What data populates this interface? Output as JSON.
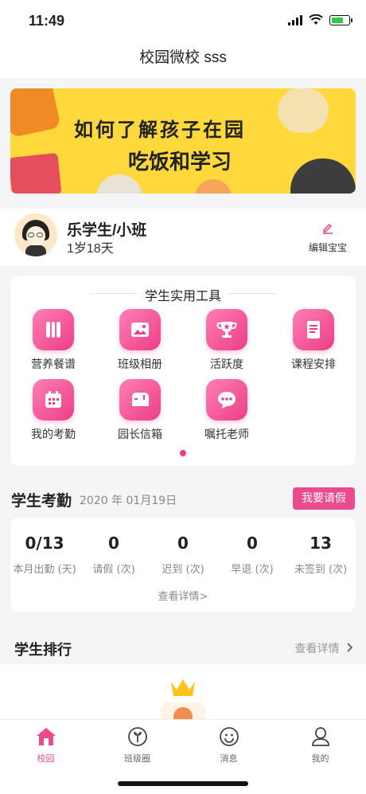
{
  "status_bar": {
    "time": "11:49"
  },
  "nav": {
    "title": "校园微校 sss"
  },
  "banner": {
    "line1": "如何了解孩子在园",
    "line2": "吃饭和学习"
  },
  "profile": {
    "name": "乐学生/小班",
    "age": "1岁18天",
    "edit_label": "编辑宝宝"
  },
  "tools": {
    "header": "学生实用工具",
    "items": [
      {
        "label": "营养餐谱",
        "icon": "utensils-icon"
      },
      {
        "label": "班级相册",
        "icon": "photo-album-icon"
      },
      {
        "label": "活跃度",
        "icon": "trophy-icon"
      },
      {
        "label": "课程安排",
        "icon": "book-icon"
      },
      {
        "label": "我的考勤",
        "icon": "calendar-icon"
      },
      {
        "label": "园长信箱",
        "icon": "mailbox-icon"
      },
      {
        "label": "嘱托老师",
        "icon": "chat-bubble-icon"
      }
    ]
  },
  "attendance": {
    "title": "学生考勤",
    "date": "2020 年 01月19日",
    "leave_button": "我要请假",
    "stats": [
      {
        "value": "0/13",
        "label": "本月出勤 (天)"
      },
      {
        "value": "0",
        "label": "请假 (次)"
      },
      {
        "value": "0",
        "label": "迟到 (次)"
      },
      {
        "value": "0",
        "label": "早退 (次)"
      },
      {
        "value": "13",
        "label": "未签到 (次)"
      }
    ],
    "more": "查看详情>"
  },
  "ranking": {
    "title": "学生排行",
    "more": "查看详情"
  },
  "tabbar": {
    "tabs": [
      {
        "label": "校园",
        "icon": "school-home-icon",
        "active": true
      },
      {
        "label": "班级圈",
        "icon": "sprout-icon",
        "active": false
      },
      {
        "label": "消息",
        "icon": "smiley-message-icon",
        "active": false
      },
      {
        "label": "我的",
        "icon": "user-profile-icon",
        "active": false
      }
    ]
  },
  "colors": {
    "accent": "#ec4a8e",
    "banner": "#ffd93b"
  }
}
